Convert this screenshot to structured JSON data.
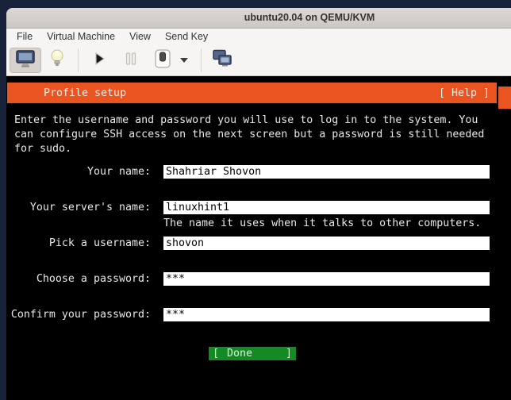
{
  "window": {
    "title": "ubuntu20.04 on QEMU/KVM"
  },
  "menubar": {
    "items": [
      "File",
      "Virtual Machine",
      "View",
      "Send Key"
    ]
  },
  "toolbar": {
    "icons": [
      "console-display",
      "show-hardware-details",
      "run",
      "pause",
      "shutdown",
      "shutdown-menu-caret",
      "fullscreen"
    ]
  },
  "installer": {
    "header": {
      "title": "Profile setup",
      "help_label": "[ Help ]"
    },
    "description_lines": [
      "Enter the username and password you will use to log in to the system. You",
      "can configure SSH access on the next screen but a password is still needed",
      "for sudo."
    ],
    "fields": [
      {
        "label": "Your name:",
        "value": "Shahriar Shovon"
      },
      {
        "label": "Your server's name:",
        "value": "linuxhint1",
        "helper": "The name it uses when it talks to other computers."
      },
      {
        "label": "Pick a username:",
        "value": "shovon"
      },
      {
        "label": "Choose a password:",
        "value": "***"
      },
      {
        "label": "Confirm your password:",
        "value": "***"
      }
    ],
    "done_button": {
      "bracket_open": "[",
      "label": "Done",
      "bracket_close": "]"
    },
    "colors": {
      "accent_orange": "#e95420",
      "button_green": "#148a25",
      "terminal_bg": "#000000"
    }
  }
}
